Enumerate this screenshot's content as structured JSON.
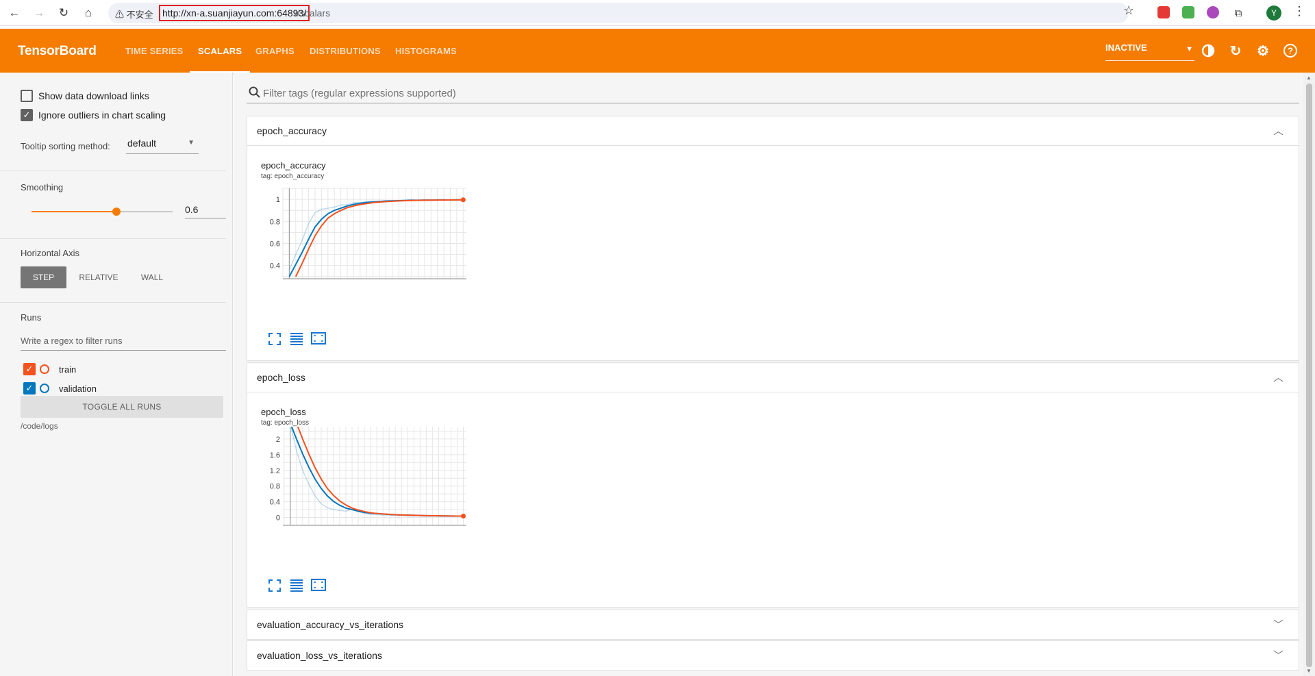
{
  "browser": {
    "security_label": "不安全",
    "url_highlight": "http://xn-a.suanjiayun.com:64893/",
    "url_rest": "#scalars",
    "avatar_letter": "Y"
  },
  "toolbar": {
    "brand": "TensorBoard",
    "tabs": [
      "TIME SERIES",
      "SCALARS",
      "GRAPHS",
      "DISTRIBUTIONS",
      "HISTOGRAMS"
    ],
    "active_tab": "SCALARS",
    "reload_select": "INACTIVE",
    "accent_color": "#f57c00"
  },
  "sidebar": {
    "show_download_links": "Show data download links",
    "ignore_outliers": "Ignore outliers in chart scaling",
    "tooltip_sort_label": "Tooltip sorting method:",
    "tooltip_sort_value": "default",
    "smoothing_label": "Smoothing",
    "smoothing_value": "0.6",
    "horizontal_axis_label": "Horizontal Axis",
    "axis_options": [
      "STEP",
      "RELATIVE",
      "WALL"
    ],
    "runs_label": "Runs",
    "runs_filter_placeholder": "Write a regex to filter runs",
    "runs": [
      {
        "name": "train",
        "color": "#f4511e",
        "checked": true
      },
      {
        "name": "validation",
        "color": "#0277bd",
        "checked": true
      }
    ],
    "toggle_all": "TOGGLE ALL RUNS",
    "logdir": "/code/logs"
  },
  "main": {
    "filter_placeholder": "Filter tags (regular expressions supported)",
    "sections": [
      {
        "title": "epoch_accuracy",
        "expanded": true
      },
      {
        "title": "epoch_loss",
        "expanded": true
      },
      {
        "title": "evaluation_accuracy_vs_iterations",
        "expanded": false
      },
      {
        "title": "evaluation_loss_vs_iterations",
        "expanded": false
      }
    ]
  },
  "chart_data": [
    {
      "type": "line",
      "title": "epoch_accuracy",
      "subtitle": "tag: epoch_accuracy",
      "xlim": [
        -1,
        27.5
      ],
      "ylim": [
        0.28,
        1.1
      ],
      "x_ticks": [
        0,
        2,
        4,
        6,
        8,
        10,
        12,
        14,
        16,
        18,
        20,
        22,
        24,
        26
      ],
      "y_ticks": [
        0.4,
        0.6,
        0.8,
        1
      ],
      "y_tick_labels": [
        "0.4",
        "0.6",
        "0.8",
        "1"
      ],
      "series": [
        {
          "name": "validation",
          "color": "#0277bd",
          "x": [
            0,
            1,
            2,
            3,
            4,
            5,
            6,
            7,
            8,
            9,
            10,
            11,
            12,
            13,
            14,
            15,
            16,
            17,
            18,
            19,
            20,
            21,
            22,
            23,
            24,
            25,
            26,
            27
          ],
          "y": [
            0.3,
            0.41,
            0.52,
            0.64,
            0.75,
            0.82,
            0.87,
            0.9,
            0.92,
            0.94,
            0.955,
            0.965,
            0.972,
            0.977,
            0.981,
            0.984,
            0.986,
            0.988,
            0.99,
            0.991,
            0.992,
            0.993,
            0.994,
            0.994,
            0.995,
            0.995,
            0.996,
            0.996
          ],
          "raw_y": [
            0.36,
            0.5,
            0.63,
            0.78,
            0.88,
            0.91,
            0.92,
            0.93,
            0.95,
            0.95,
            0.97,
            0.97,
            0.98,
            0.98,
            0.98,
            0.99,
            0.99,
            0.99,
            0.99,
            1.0,
            0.99,
            1.0,
            0.99,
            1.0,
            1.0,
            0.99,
            1.0,
            1.0
          ]
        },
        {
          "name": "train",
          "color": "#f4511e",
          "x": [
            1,
            2,
            3,
            4,
            5,
            6,
            7,
            8,
            9,
            10,
            11,
            12,
            13,
            14,
            15,
            16,
            17,
            18,
            19,
            20,
            21,
            22,
            23,
            24,
            25,
            26,
            27
          ],
          "y": [
            0.3,
            0.42,
            0.55,
            0.67,
            0.76,
            0.83,
            0.87,
            0.9,
            0.925,
            0.94,
            0.953,
            0.962,
            0.97,
            0.976,
            0.98,
            0.983,
            0.986,
            0.988,
            0.99,
            0.991,
            0.992,
            0.993,
            0.994,
            0.994,
            0.995,
            0.995,
            0.996
          ]
        }
      ]
    },
    {
      "type": "line",
      "title": "epoch_loss",
      "subtitle": "tag: epoch_loss",
      "xlim": [
        -1.2,
        28.5
      ],
      "ylim": [
        -0.2,
        2.4
      ],
      "x_ticks": [
        0,
        4,
        8,
        12,
        16,
        20,
        24
      ],
      "y_ticks": [
        0,
        0.4,
        0.8,
        1.2,
        1.6,
        2
      ],
      "y_tick_labels": [
        "0",
        "0.4",
        "0.8",
        "1.2",
        "1.6",
        "2"
      ],
      "series": [
        {
          "name": "validation",
          "color": "#0277bd",
          "x": [
            0,
            1,
            2,
            3,
            4,
            5,
            6,
            7,
            8,
            9,
            10,
            11,
            12,
            13,
            14,
            15,
            16,
            17,
            18,
            19,
            20,
            21,
            22,
            23,
            24,
            25,
            26,
            27,
            28
          ],
          "y": [
            2.4,
            2.0,
            1.62,
            1.28,
            0.98,
            0.74,
            0.55,
            0.41,
            0.31,
            0.24,
            0.2,
            0.16,
            0.13,
            0.11,
            0.1,
            0.09,
            0.08,
            0.07,
            0.065,
            0.06,
            0.055,
            0.05,
            0.047,
            0.045,
            0.042,
            0.04,
            0.038,
            0.036,
            0.035
          ],
          "raw_y": [
            2.4,
            1.7,
            1.2,
            0.85,
            0.55,
            0.35,
            0.25,
            0.2,
            0.18,
            0.16,
            0.22,
            0.15,
            0.1,
            0.08,
            0.07,
            0.06,
            0.06,
            0.05,
            0.05,
            0.04,
            0.04,
            0.04,
            0.03,
            0.03,
            0.03,
            0.03,
            0.03,
            0.03,
            0.03
          ]
        },
        {
          "name": "train",
          "color": "#f4511e",
          "x": [
            1,
            2,
            3,
            4,
            5,
            6,
            7,
            8,
            9,
            10,
            11,
            12,
            13,
            14,
            15,
            16,
            17,
            18,
            19,
            20,
            21,
            22,
            23,
            24,
            25,
            26,
            27,
            28
          ],
          "y": [
            2.4,
            2.0,
            1.62,
            1.27,
            0.98,
            0.74,
            0.56,
            0.42,
            0.32,
            0.24,
            0.19,
            0.15,
            0.12,
            0.1,
            0.09,
            0.08,
            0.07,
            0.065,
            0.06,
            0.055,
            0.05,
            0.047,
            0.045,
            0.042,
            0.04,
            0.038,
            0.036,
            0.035
          ]
        }
      ]
    }
  ]
}
